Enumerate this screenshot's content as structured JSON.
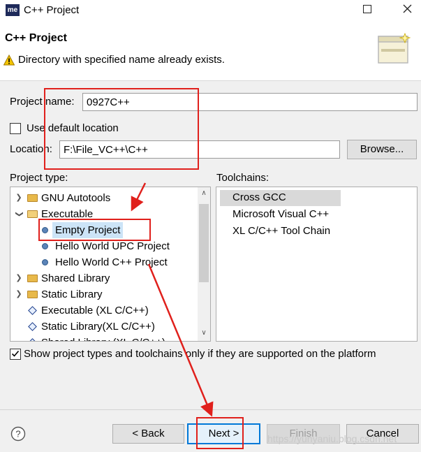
{
  "window": {
    "title": "C++ Project",
    "app_icon_text": "me"
  },
  "banner": {
    "title": "C++ Project",
    "message": "Directory with specified name already exists."
  },
  "form": {
    "project_name_label": "Project name:",
    "project_name_value": "0927C++",
    "use_default_label": "Use default location",
    "use_default_checked": false,
    "location_label": "Location:",
    "location_value": "F:\\File_VC++\\C++",
    "browse_label": "Browse..."
  },
  "project_type": {
    "label": "Project type:",
    "items": [
      {
        "label": "GNU Autotools",
        "kind": "folder",
        "expanded": false
      },
      {
        "label": "Executable",
        "kind": "folder",
        "expanded": true
      },
      {
        "label": "Empty Project",
        "kind": "bullet",
        "selected": true
      },
      {
        "label": "Hello World UPC Project",
        "kind": "bullet"
      },
      {
        "label": "Hello World C++ Project",
        "kind": "bullet"
      },
      {
        "label": "Shared Library",
        "kind": "folder",
        "expanded": false
      },
      {
        "label": "Static Library",
        "kind": "folder",
        "expanded": false
      },
      {
        "label": "Executable (XL C/C++)",
        "kind": "diamond"
      },
      {
        "label": "Static Library(XL C/C++)",
        "kind": "diamond"
      },
      {
        "label": "Shared Library (XL C/C++)",
        "kind": "diamond"
      }
    ]
  },
  "toolchains": {
    "label": "Toolchains:",
    "items": [
      "Cross GCC",
      "Microsoft Visual C++",
      "XL C/C++ Tool Chain"
    ],
    "selected_index": 0
  },
  "filter": {
    "label": "Show project types and toolchains only if they are supported on the platform",
    "checked": true
  },
  "buttons": {
    "back": "< Back",
    "next": "Next >",
    "finish": "Finish",
    "cancel": "Cancel"
  },
  "watermark": "https://yunyaniu.blog.csdn.net",
  "colors": {
    "annotation_red": "#e0201c",
    "selection_blue": "#cce4f7",
    "default_button_border": "#0078d7"
  }
}
